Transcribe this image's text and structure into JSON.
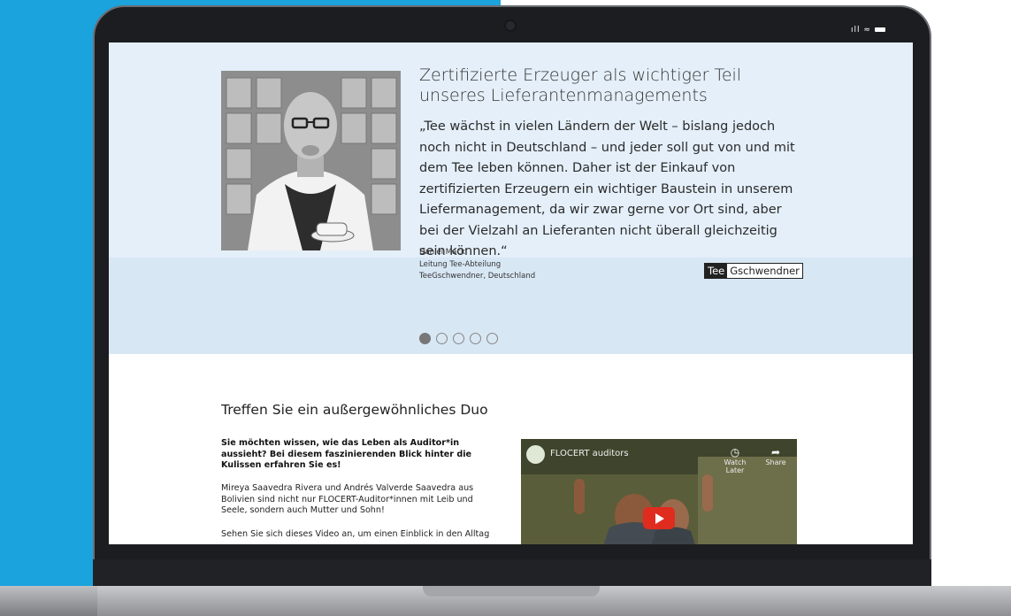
{
  "device": {
    "status_icons": "ıll ≈"
  },
  "testimonial": {
    "headline": "Zertifizierte Erzeuger als wichtiger Teil unseres Lieferantenmanagements",
    "quote": "„Tee wächst in vielen Ländern der Welt – bislang jedoch noch nicht in Deutschland – und jeder soll gut von und mit dem Tee leben können. Daher ist der Einkauf von zertifizierten Erzeugern ein wichtiger Baustein in unserem Liefermanagement, da wir zwar gerne vor Ort sind, aber bei der Vielzahl an Lieferanten nicht überall gleichzeitig sein können.“",
    "author_name": "Daniel Mack",
    "author_role": "Leitung Tee-Abteilung",
    "author_company": "TeeGschwendner, Deutschland",
    "logo_part1": "Tee",
    "logo_part2": "Gschwendner",
    "active_slide": 1,
    "slide_count": 5
  },
  "duo": {
    "title": "Treffen Sie ein außergewöhnliches Duo",
    "intro": "Sie möchten wissen, wie das Leben als Auditor*in aussieht? Bei diesem faszinierenden Blick hinter die Kulissen erfahren Sie es!",
    "paragraph1": "Mireya Saavedra Rivera und Andrés Valverde Saavedra aus Bolivien sind nicht nur FLOCERT-Auditor*innen mit Leib und Seele, sondern auch Mutter und Sohn!",
    "paragraph2": "Sehen Sie sich dieses Video an, um einen Einblick in den Alltag"
  },
  "video": {
    "title": "FLOCERT auditors",
    "watch_later": "Watch Later",
    "share": "Share",
    "watch_later_icon": "clock-icon",
    "share_icon": "share-icon",
    "play_icon": "play-icon"
  },
  "colors": {
    "background_blue": "#1ba3dd",
    "hero_bg": "#e4eff9",
    "play_red": "#e02b1f"
  }
}
